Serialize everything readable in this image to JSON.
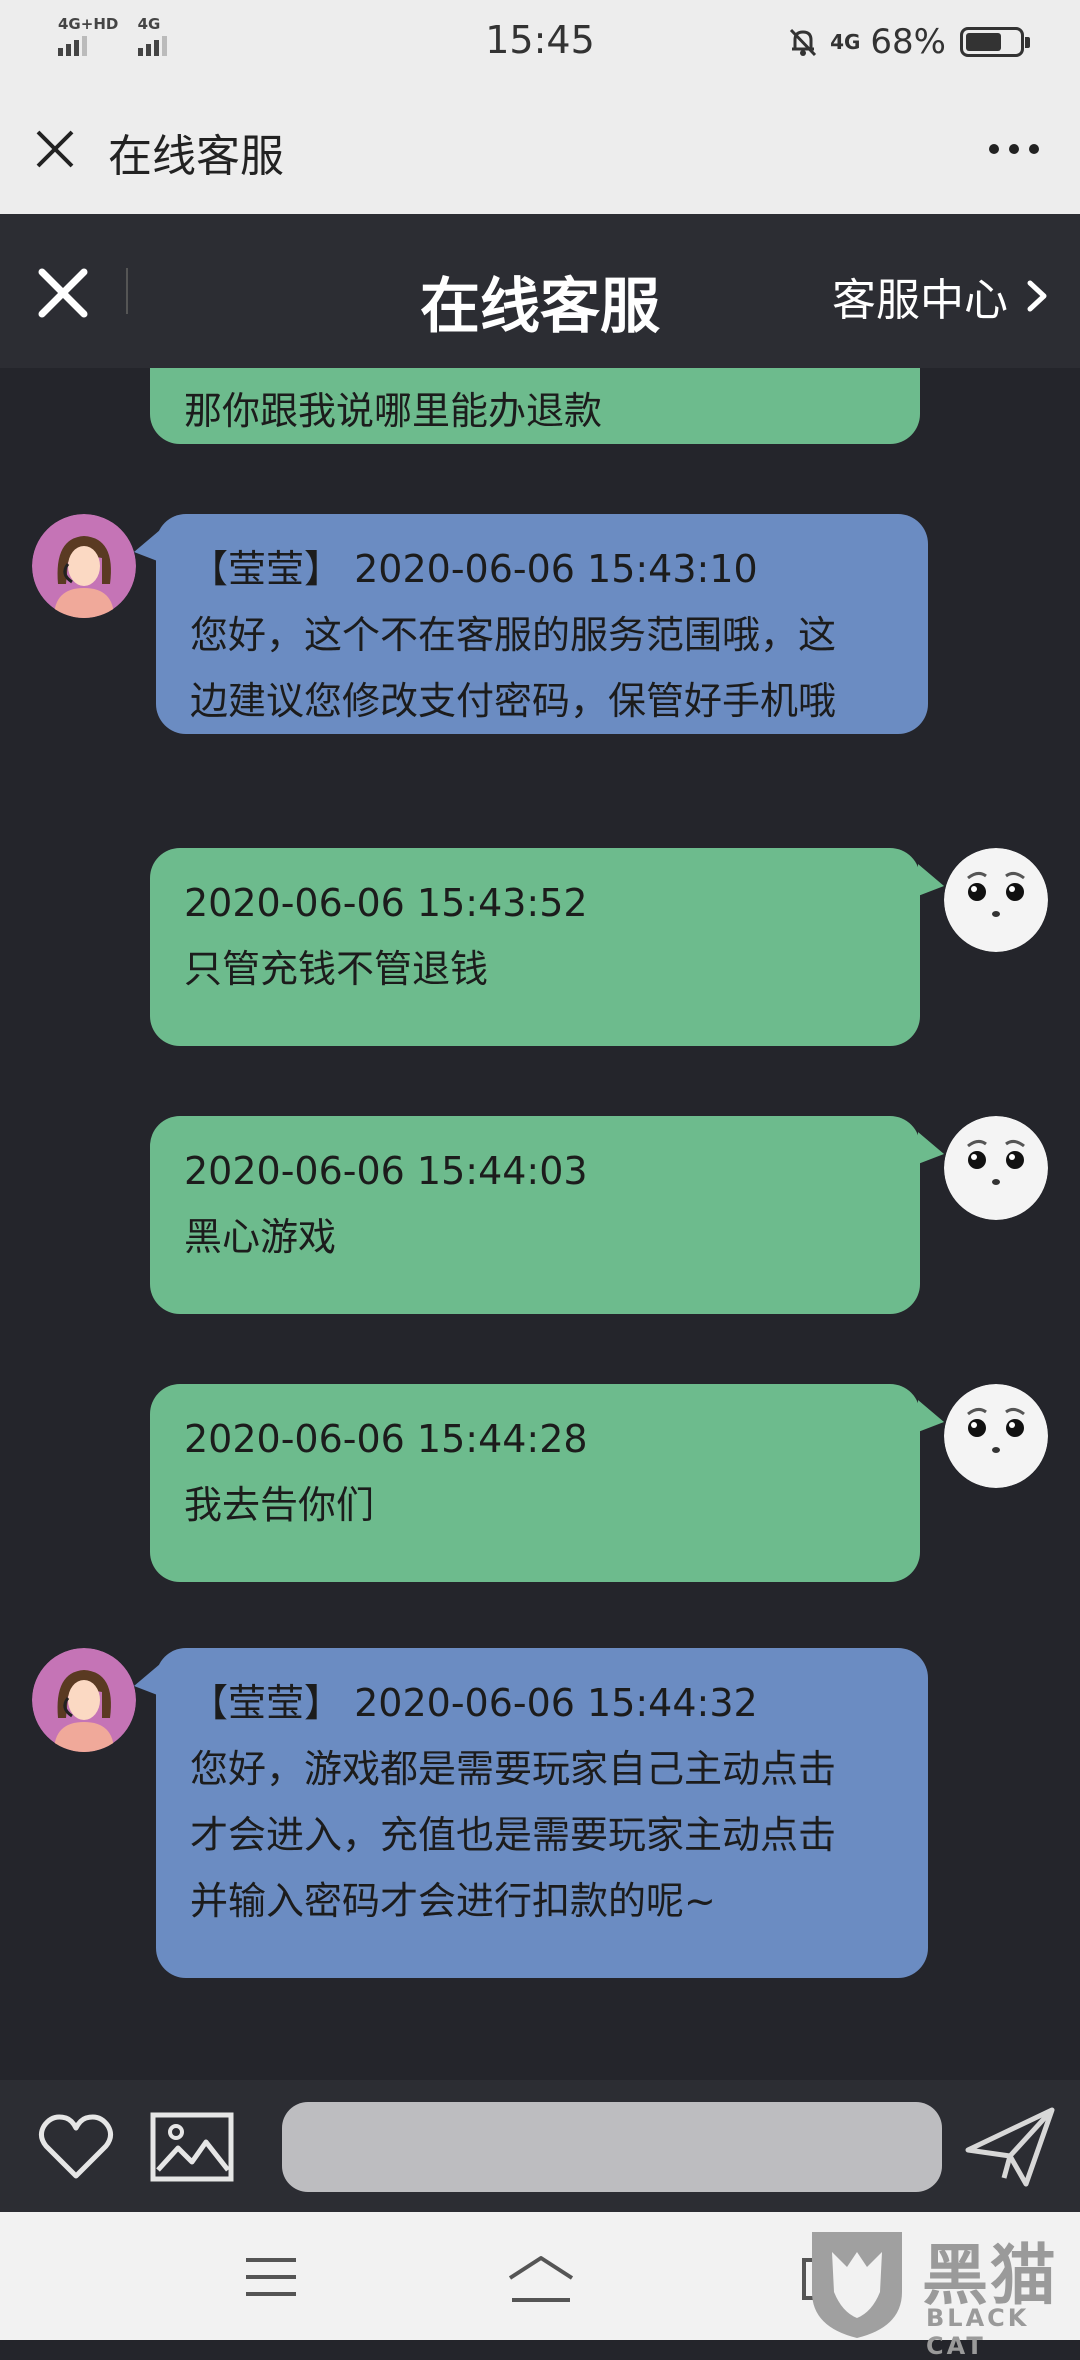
{
  "status_bar": {
    "network_1": "4G+HD",
    "network_2": "4G",
    "time": "15:45",
    "network_3": "4G",
    "battery_percent": "68%",
    "battery_level": 0.68
  },
  "browser_bar": {
    "title": "在线客服"
  },
  "app_bar": {
    "title": "在线客服",
    "right_link": "客服中心"
  },
  "messages": [
    {
      "side": "user",
      "lines": [
        "那你跟我说哪里能办退款"
      ]
    },
    {
      "side": "agent",
      "sender": "【莹莹】",
      "time": "2020-06-06 15:43:10",
      "lines": [
        "您好，这个不在客服的服务范围哦，这",
        "边建议您修改支付密码，保管好手机哦"
      ]
    },
    {
      "side": "user",
      "time": "2020-06-06 15:43:52",
      "lines": [
        "只管充钱不管退钱"
      ]
    },
    {
      "side": "user",
      "time": "2020-06-06 15:44:03",
      "lines": [
        "黑心游戏"
      ]
    },
    {
      "side": "user",
      "time": "2020-06-06 15:44:28",
      "lines": [
        "我去告你们"
      ]
    },
    {
      "side": "agent",
      "sender": "【莹莹】",
      "time": "2020-06-06 15:44:32",
      "lines": [
        "您好，游戏都是需要玩家自己主动点击",
        "才会进入，充值也是需要玩家主动点击",
        "并输入密码才会进行扣款的呢~"
      ]
    }
  ],
  "input_bar": {
    "placeholder": ""
  },
  "watermark": {
    "text": "黑猫",
    "sub": "BLACK CAT"
  },
  "colors": {
    "user_bubble": "#6dbb8d",
    "agent_bubble": "#6b8cc2",
    "chat_background": "#24252b",
    "header_background": "#2c2d33"
  }
}
